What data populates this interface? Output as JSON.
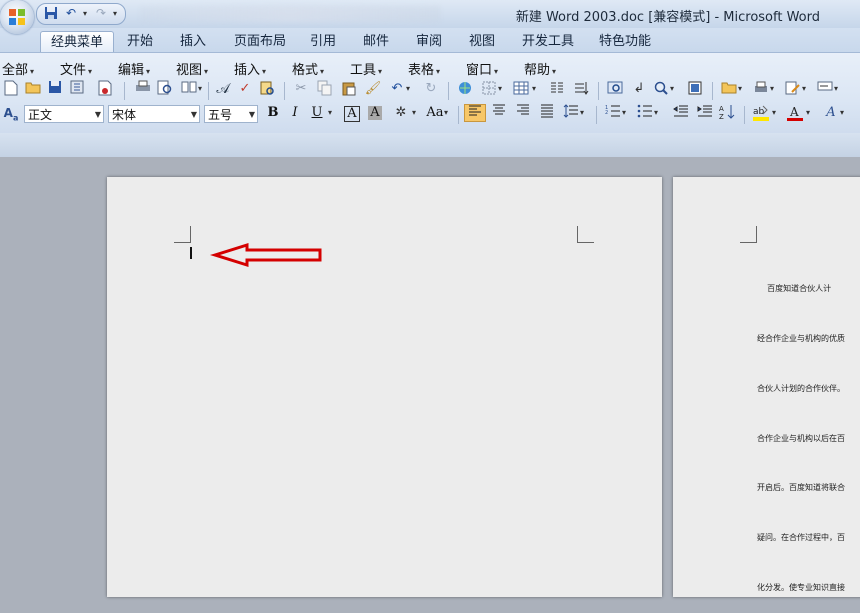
{
  "window": {
    "title": "新建 Word 2003.doc [兼容模式] - Microsoft Word"
  },
  "quick_access": {
    "icons": [
      "save-icon",
      "undo-icon",
      "redo-icon"
    ]
  },
  "ribbon_tabs": [
    {
      "label": "经典菜单",
      "active": true
    },
    {
      "label": "开始"
    },
    {
      "label": "插入"
    },
    {
      "label": "页面布局"
    },
    {
      "label": "引用"
    },
    {
      "label": "邮件"
    },
    {
      "label": "审阅"
    },
    {
      "label": "视图"
    },
    {
      "label": "开发工具"
    },
    {
      "label": "特色功能"
    }
  ],
  "classic_menu": [
    "全部",
    "文件",
    "编辑",
    "视图",
    "插入",
    "格式",
    "工具",
    "表格",
    "窗口",
    "帮助"
  ],
  "format_bar": {
    "style": "正文",
    "font": "宋体",
    "size": "五号",
    "bold": "B",
    "italic": "I",
    "underline": "U",
    "char_border": "A",
    "char_shading": "A",
    "change_case": "Aa"
  },
  "colors": {
    "highlight": "#ffe600",
    "font_color": "#d40000",
    "arrow": "#d40000",
    "active_align": "#f7c768"
  },
  "document": {
    "page2_lines": [
      "    百度知道合伙人计",
      "经合作企业与机构的优质",
      "合伙人计划的合作伙伴。",
      "合作企业与机构以后在百",
      "开启后。百度知道将联合",
      "疑问。在合作过程中，百",
      "化分发。使专业知识直接"
    ]
  }
}
